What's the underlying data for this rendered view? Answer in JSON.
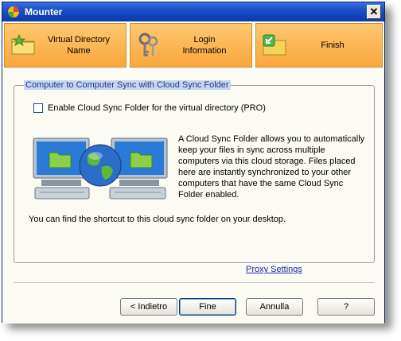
{
  "window": {
    "title": "Mounter"
  },
  "steps": [
    {
      "label_line1": "Virtual Directory",
      "label_line2": "Name",
      "icon": "folder-star-icon"
    },
    {
      "label_line1": "Login",
      "label_line2": "Information",
      "icon": "keys-icon"
    },
    {
      "label_line1": "Finish",
      "label_line2": "",
      "icon": "folder-arrow-icon"
    }
  ],
  "group": {
    "title": "Computer to Computer Sync with Cloud Sync Folder",
    "checkbox_label": "Enable Cloud Sync Folder for the virtual directory (PRO)",
    "checkbox_checked": false,
    "description": "A Cloud Sync Folder allows you to automatically keep your files in sync across multiple computers via this cloud storage. Files placed here are instantly synchronized to your other computers that have the same Cloud Sync Folder enabled.",
    "shortcut_text": "You can find the shortcut to this cloud sync folder on your desktop."
  },
  "proxy_link": "Proxy Settings",
  "buttons": {
    "back": "< Indietro",
    "finish": "Fine",
    "cancel": "Annulla",
    "help": "?"
  },
  "colors": {
    "title_bar": "#1b4fc9",
    "step_bg": "#f9a63e",
    "group_title_bg": "#c8d4f0"
  }
}
